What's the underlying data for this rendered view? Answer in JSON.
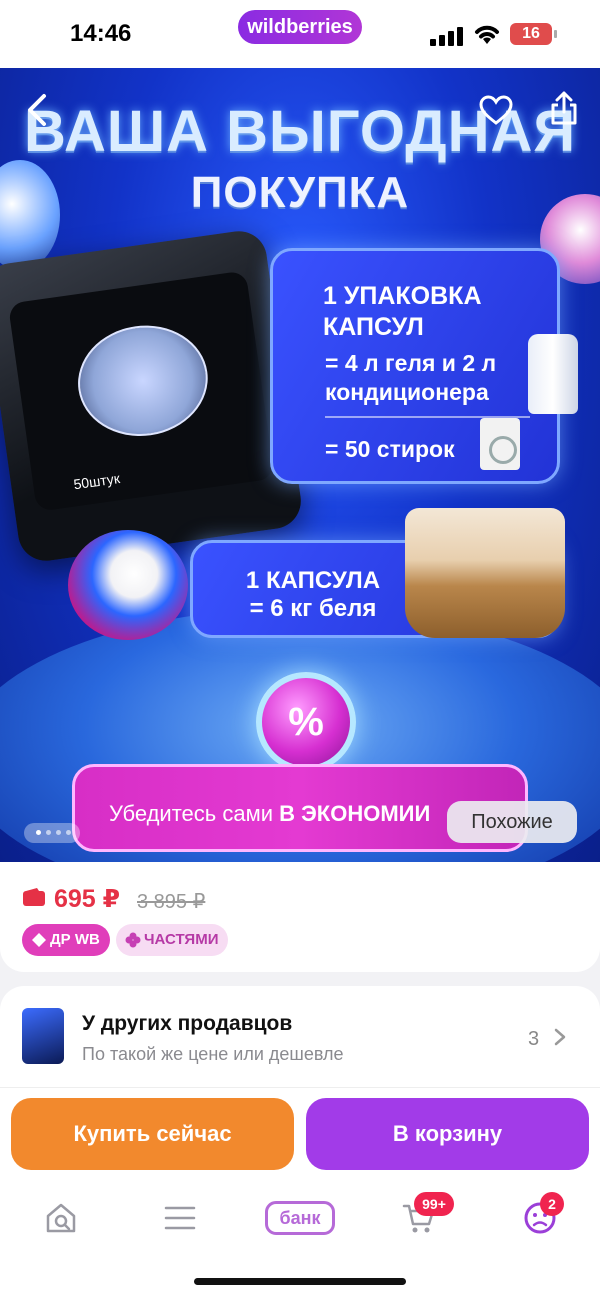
{
  "status_bar": {
    "time": "14:46",
    "brand": "wildberries",
    "battery": "16"
  },
  "hero": {
    "title_line1": "ВАША ВЫГОДНАЯ",
    "title_line2": "ПОКУПКА",
    "card1": {
      "title_line1": "1 УПАКОВКА",
      "title_line2": "КАПСУЛ",
      "line1a": "= 4 л геля и 2 л",
      "line1b": "кондиционера",
      "line2": "= 50 стирок"
    },
    "card2": {
      "line1": "1 КАПСУЛА",
      "line2": "= 6 кг беля"
    },
    "product_count": "50штук",
    "promo_symbol": "%",
    "promo_text_regular": "Убедитесь сами ",
    "promo_text_bold": "В ЭКОНОМИИ",
    "similar_label": "Похожие",
    "pager": {
      "current": 1,
      "total": 4
    }
  },
  "price": {
    "current": "695 ₽",
    "old": "3 895 ₽",
    "tags": [
      "ДР WB",
      "ЧАСТЯМИ"
    ]
  },
  "sellers": {
    "title": "У других продавцов",
    "subtitle": "По такой же цене или дешевле",
    "count": "3"
  },
  "actions": {
    "buy_now": "Купить сейчас",
    "add_to_cart": "В корзину"
  },
  "tabbar": {
    "bank_label": "банк",
    "cart_badge": "99+",
    "profile_badge": "2"
  },
  "colors": {
    "price_red": "#e53146",
    "buy_orange": "#f2892d",
    "cart_purple": "#a23be8",
    "brand_purple": "#8a2be2"
  },
  "icons": [
    "back-arrow-icon",
    "heart-icon",
    "share-icon",
    "wallet-icon",
    "diamond-icon",
    "clover-icon",
    "chevron-right-icon",
    "home-search-icon",
    "menu-icon",
    "cart-icon",
    "profile-icon"
  ]
}
